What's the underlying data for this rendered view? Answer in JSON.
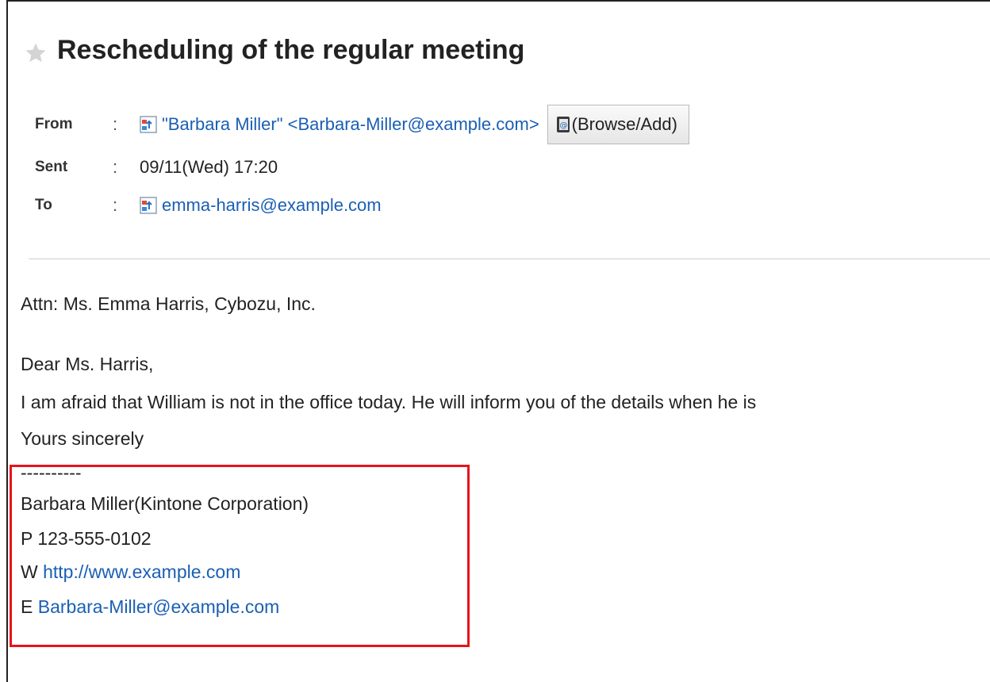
{
  "message": {
    "title": "Rescheduling of the regular meeting",
    "header": {
      "from_label": "From",
      "sent_label": "Sent",
      "to_label": "To",
      "separator": ":",
      "from_value": "\"Barbara Miller\" <Barbara-Miller@example.com>",
      "browse_add_label": "(Browse/Add)",
      "sent_value": "09/11(Wed) 17:20",
      "to_value": "emma-harris@example.com"
    },
    "body": {
      "attn": "Attn: Ms. Emma Harris, Cybozu, Inc.",
      "greeting": "Dear Ms. Harris,",
      "paragraph": "I am afraid that William is not in the office today. He will inform you of the details when he is",
      "closing": "Yours sincerely"
    },
    "signature": {
      "separator": "----------",
      "name": "Barbara Miller(Kintone Corporation)",
      "phone": "P 123-555-0102",
      "web_prefix": "W ",
      "web_url": "http://www.example.com",
      "email_prefix": "E ",
      "email": "Barbara-Miller@example.com"
    }
  },
  "colors": {
    "link": "#1a5fb4",
    "highlight_box": "#e8121b",
    "star": "#cfcfcf"
  },
  "icons": {
    "star": "star-icon",
    "address": "address-card-icon",
    "address_book": "address-book-icon"
  }
}
